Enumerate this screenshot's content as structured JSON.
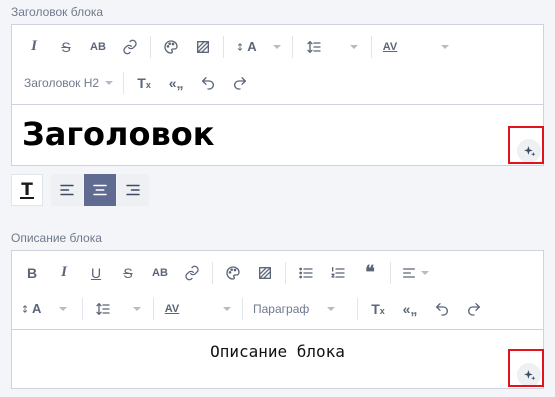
{
  "block_title": {
    "section_label": "Заголовок блока",
    "heading_select": "Заголовок H2",
    "content": "Заголовок",
    "toolbar_row1": {
      "bold_ab": "AB",
      "font_size_label": "A",
      "letter_spacing": "AV"
    }
  },
  "block_description": {
    "section_label": "Описание блока",
    "paragraph_select": "Параграф",
    "content": "Описание блока",
    "toolbar_row1": {
      "bold": "B",
      "italic": "I",
      "underline": "U",
      "ab": "AB"
    },
    "toolbar_row2": {
      "font_size_label": "A",
      "letter_spacing": "AV"
    }
  },
  "colors": {
    "accent": "#5f6b91",
    "highlight_box": "#e0141e",
    "border": "#cfd4dc"
  }
}
